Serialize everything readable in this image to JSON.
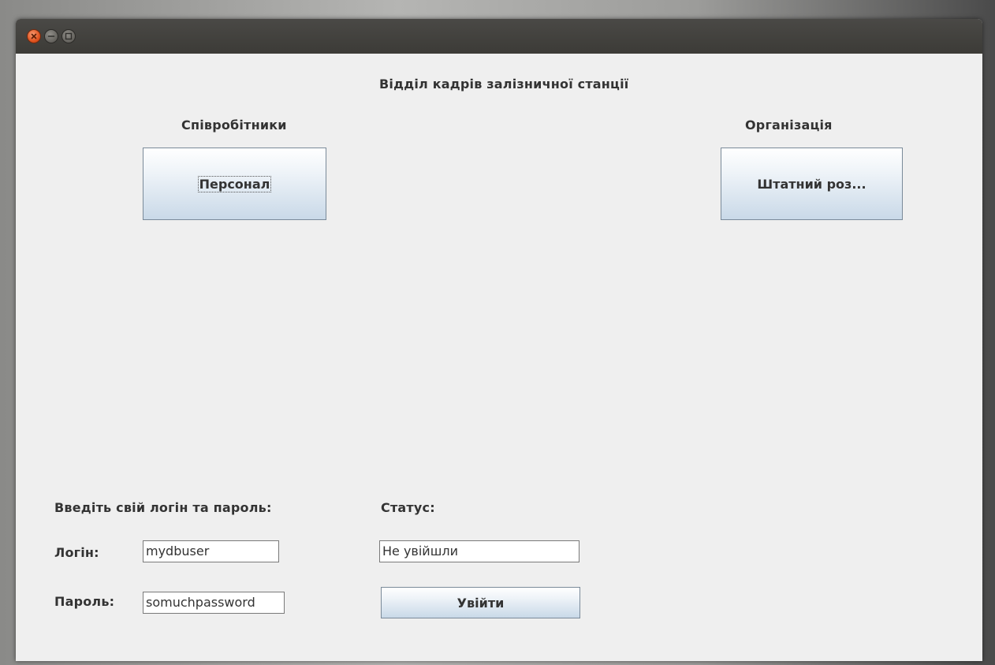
{
  "window": {
    "title": "",
    "controls": [
      "close-icon",
      "minimize-icon",
      "maximize-icon"
    ]
  },
  "header": {
    "title": "Відділ кадрів залізничної станції"
  },
  "sections": {
    "employees": {
      "label": "Співробітники",
      "button_label": "Персонал"
    },
    "organization": {
      "label": "Організація",
      "button_label": "Штатний роз..."
    }
  },
  "login": {
    "prompt": "Введіть свій логін та пароль:",
    "login_label": "Логін:",
    "login_value": "mydbuser",
    "password_label": "Пароль:",
    "password_value": "somuchpassword",
    "status_label": "Статус:",
    "status_value": "Не увійшли",
    "submit_label": "Увійти"
  },
  "colors": {
    "window_bg": "#efefef",
    "titlebar": "#3c3b37",
    "close_button": "#e0531f",
    "button_gradient_bottom": "#c9d9e8"
  }
}
